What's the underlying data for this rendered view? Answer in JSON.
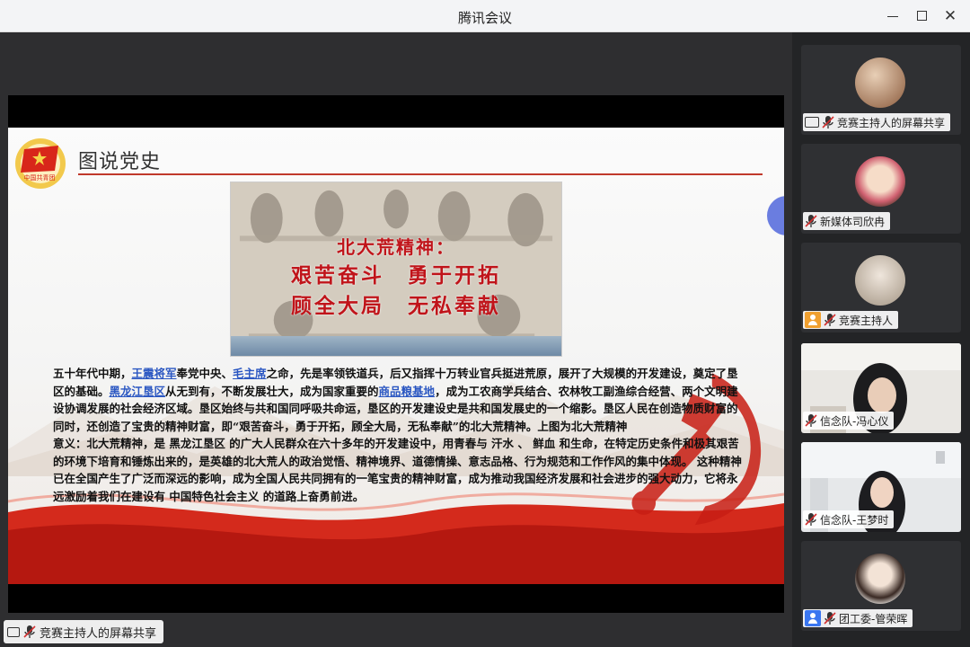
{
  "window": {
    "title": "腾讯会议"
  },
  "slide": {
    "title": "图说党史",
    "photo_caption": [
      "北大荒精神：",
      "艰苦奋斗　勇于开拓",
      "顾全大局　无私奉献"
    ],
    "paragraphs": [
      [
        {
          "t": "五十年代中期，"
        },
        {
          "t": "王震将军",
          "link": true
        },
        {
          "t": "奉党中央、"
        },
        {
          "t": "毛主席",
          "link": true
        },
        {
          "t": "之命，先是率领铁道兵，后又指挥十万转业官兵挺进荒原，展开了大规模的开发建设，奠定了垦区的基础。"
        },
        {
          "t": "黑龙江垦区",
          "link": true
        },
        {
          "t": "从无到有，不断发展壮大，成为国家重要的"
        },
        {
          "t": "商品粮基地",
          "link": true
        },
        {
          "t": "，成为工农商学兵结合、农林牧工副渔综合经营、两个文明建设协调发展的社会经济区域。垦区始终与共和国同呼吸共命运，垦区的开发建设史是共和国发展史的一个缩影。垦区人民在创造物质财富的同时，还创造了宝贵的精神财富，即“艰苦奋斗，勇于开拓，顾全大局，无私奉献”的北大荒精神。上图为北大荒精神"
        }
      ],
      [
        {
          "t": "意义：北大荒精神，是 黑龙江垦区 的广大人民群众在六十多年的开发建设中，用青春与 汗水 、 鲜血 和生命，在特定历史条件和极其艰苦的环境下培育和锤炼出来的，是英雄的北大荒人的政治觉悟、精神境界、道德情操、意志品格、行为规范和工作作风的集中体现。 这种精神已在全国产生了广泛而深远的影响，成为全国人民共同拥有的一笔宝贵的精神财富，成为推动我国经济发展和社会进步的强大动力，它将永远激励着我们在建设有 中国特色社会主义 的道路上奋勇前进。"
        }
      ]
    ]
  },
  "share_label": "竞赛主持人的屏幕共享",
  "participants": [
    {
      "name": "竞赛主持人的屏幕共享",
      "badge": "screen"
    },
    {
      "name": "新媒体司欣冉",
      "badge": "none"
    },
    {
      "name": "竞赛主持人",
      "badge": "orange"
    },
    {
      "name": "信念队-冯心仪",
      "badge": "none"
    },
    {
      "name": "信念队-王梦时",
      "badge": "none"
    },
    {
      "name": "团工委-管荣晖",
      "badge": "blue"
    }
  ],
  "colors": {
    "accent_red": "#c0141a",
    "link_blue": "#2b57c2",
    "panel_bg": "#232426"
  }
}
